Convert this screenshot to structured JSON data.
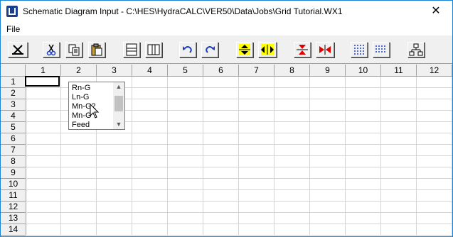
{
  "window": {
    "title": "Schematic Diagram Input - C:\\HES\\HydraCALC\\VER50\\Data\\Jobs\\Grid Tutorial.WX1",
    "close_label": "✕"
  },
  "menu": {
    "file_label": "File"
  },
  "toolbar": {
    "buttons": [
      "delete-icon",
      "cut-icon",
      "copy-icon",
      "paste-icon",
      "split-horizontal-icon",
      "split-vertical-icon",
      "undo-icon",
      "redo-icon",
      "expand-vertical-icon",
      "expand-horizontal-icon",
      "collapse-vertical-icon",
      "collapse-horizontal-icon",
      "grid-columns-icon",
      "grid-rows-icon",
      "tree-icon"
    ]
  },
  "grid": {
    "columns": [
      "1",
      "2",
      "3",
      "4",
      "5",
      "6",
      "7",
      "8",
      "9",
      "10",
      "11",
      "12"
    ],
    "rows": [
      "1",
      "2",
      "3",
      "4",
      "5",
      "6",
      "7",
      "8",
      "9",
      "10",
      "11",
      "12",
      "13",
      "14"
    ],
    "active_cell": {
      "row": "1",
      "col": "1"
    }
  },
  "dropdown_list": {
    "items": [
      "Rn-G",
      "Ln-G",
      "Mn-G2",
      "Mn-G",
      "Feed"
    ],
    "scroll_up": "▲",
    "scroll_down": "▼"
  },
  "colors": {
    "accent_border": "#1883d7",
    "icon_yellow": "#ffff00",
    "icon_red": "#e00000",
    "icon_blue": "#1a3fbf"
  }
}
